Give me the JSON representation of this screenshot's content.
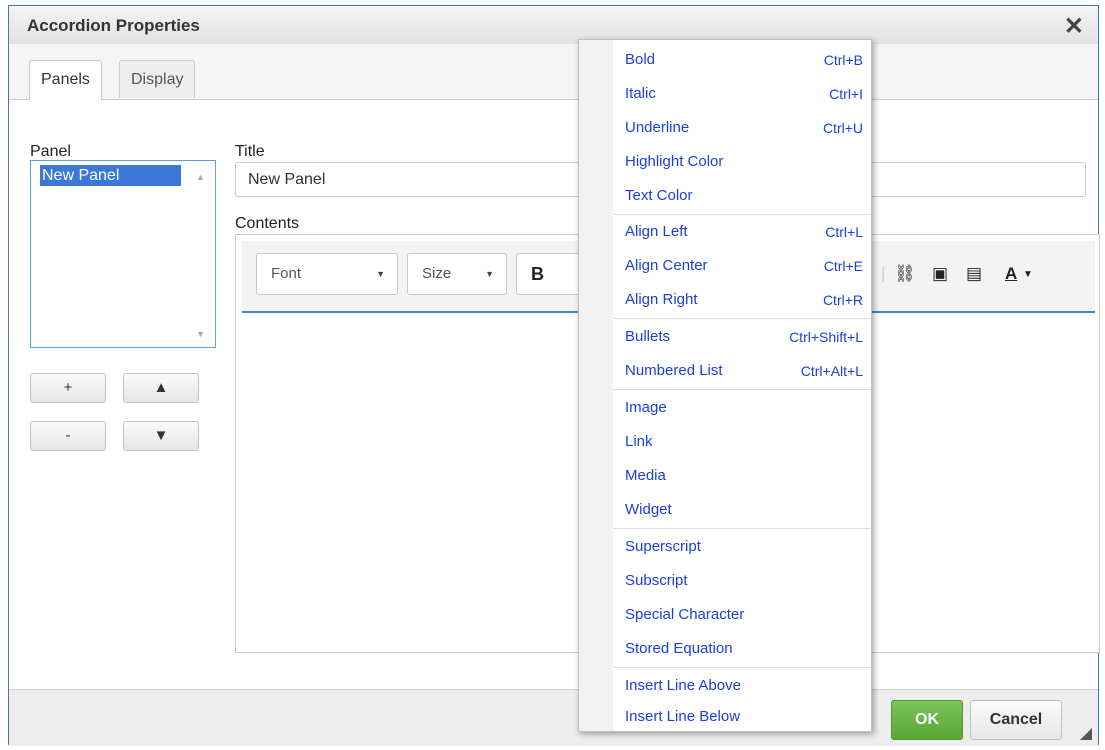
{
  "dialog": {
    "title": "Accordion Properties",
    "close_label": "✕"
  },
  "tabs": [
    {
      "label": "Panels",
      "active": true
    },
    {
      "label": "Display",
      "active": false
    }
  ],
  "panel": {
    "label": "Panel",
    "items": [
      "New Panel"
    ],
    "add_label": "+",
    "remove_label": "-",
    "up_label": "▲",
    "down_label": "▼"
  },
  "title_field": {
    "label": "Title",
    "value": "New Panel"
  },
  "contents": {
    "label": "Contents",
    "font_label": "Font",
    "size_label": "Size",
    "bold_label": "B",
    "text_color_label": "A"
  },
  "context_menu": {
    "groups": [
      [
        {
          "label": "Bold",
          "shortcut": "Ctrl+B"
        },
        {
          "label": "Italic",
          "shortcut": "Ctrl+I"
        },
        {
          "label": "Underline",
          "shortcut": "Ctrl+U"
        },
        {
          "label": "Highlight Color",
          "shortcut": ""
        },
        {
          "label": "Text Color",
          "shortcut": ""
        }
      ],
      [
        {
          "label": "Align Left",
          "shortcut": "Ctrl+L"
        },
        {
          "label": "Align Center",
          "shortcut": "Ctrl+E"
        },
        {
          "label": "Align Right",
          "shortcut": "Ctrl+R"
        }
      ],
      [
        {
          "label": "Bullets",
          "shortcut": "Ctrl+Shift+L"
        },
        {
          "label": "Numbered List",
          "shortcut": "Ctrl+Alt+L"
        }
      ],
      [
        {
          "label": "Image",
          "shortcut": ""
        },
        {
          "label": "Link",
          "shortcut": ""
        },
        {
          "label": "Media",
          "shortcut": ""
        },
        {
          "label": "Widget",
          "shortcut": ""
        }
      ],
      [
        {
          "label": "Superscript",
          "shortcut": ""
        },
        {
          "label": "Subscript",
          "shortcut": ""
        },
        {
          "label": "Special Character",
          "shortcut": ""
        },
        {
          "label": "Stored Equation",
          "shortcut": ""
        }
      ],
      [
        {
          "label": "Insert Line Above",
          "shortcut": ""
        },
        {
          "label": "Insert Line Below",
          "shortcut": ""
        }
      ]
    ]
  },
  "footer": {
    "ok_label": "OK",
    "cancel_label": "Cancel"
  },
  "colors": {
    "accent": "#3c78d8",
    "menu_text": "#1a3fe0",
    "ok_green": "#58a633"
  }
}
